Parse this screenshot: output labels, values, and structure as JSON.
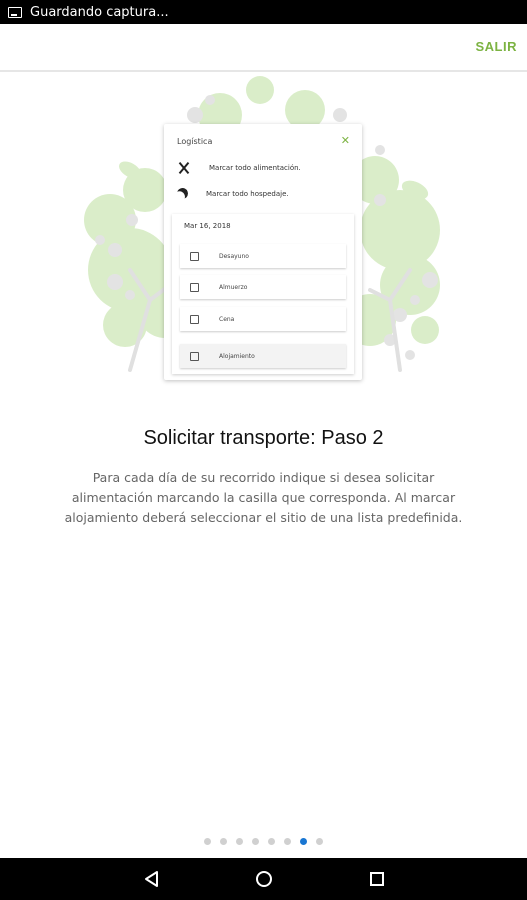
{
  "status_bar": {
    "text": "Guardando captura..."
  },
  "top_bar": {
    "exit_label": "SALIR"
  },
  "mock_screen": {
    "title": "Logística",
    "close_symbol": "✕",
    "rows": [
      {
        "icon": "fork-knife-icon",
        "label": "Marcar todo alimentación."
      },
      {
        "icon": "moon-icon",
        "label": "Marcar todo hospedaje."
      }
    ],
    "date": "Mar 16, 2018",
    "items": [
      {
        "label": "Desayuno"
      },
      {
        "label": "Almuerzo"
      },
      {
        "label": "Cena"
      },
      {
        "label": "Alojamiento"
      }
    ]
  },
  "headline": "Solicitar transporte: Paso 2",
  "description": "Para cada día de su recorrido indique si desea solicitar alimentación marcando la casilla que corresponda. Al marcar alojamiento deberá seleccionar el sitio de una lista predefinida.",
  "pagination": {
    "total": 8,
    "active_index": 6
  },
  "nav": {
    "back": "back-icon",
    "home": "home-icon",
    "recent": "recent-apps-icon"
  },
  "colors": {
    "accent": "#7cb342",
    "active_dot": "#1976d2",
    "tree": "#c8e6b0"
  }
}
